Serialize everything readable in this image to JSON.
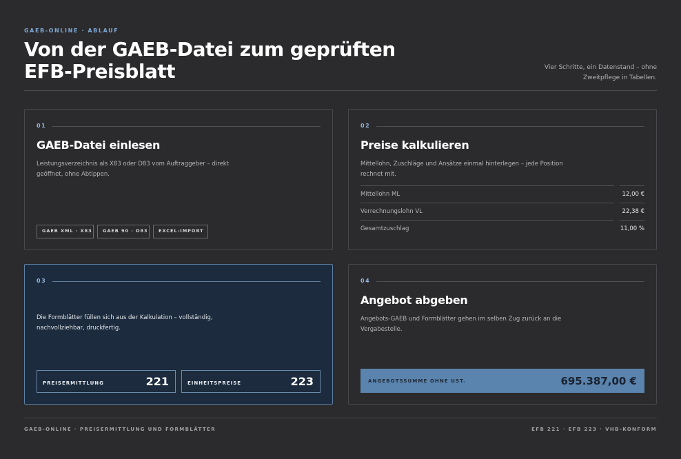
{
  "header": {
    "eyebrow": "GAEB-ONLINE · ABLAUF",
    "title": "Von der GAEB-Datei zum geprüften EFB-Preisblatt",
    "subtitle": "Vier Schritte, ein Datenstand – ohne Zweitpflege in Tabellen."
  },
  "steps": [
    {
      "num": "01",
      "title": "GAEB-Datei einlesen",
      "desc": "Leistungsverzeichnis als X83 oder D83 vom Auftraggeber – direkt geöffnet, ohne Abtippen.",
      "tags": [
        "GAEB XML · X83",
        "GAEB 90 · D83",
        "EXCEL-IMPORT"
      ]
    },
    {
      "num": "02",
      "title": "Preise kalkulieren",
      "desc": "Mittellohn, Zuschläge und Ansätze einmal hinterlegen – jede Position rechnet mit.",
      "params": [
        {
          "label": "Mittellohn ML",
          "value": "12,00 €"
        },
        {
          "label": "Verrechnungslohn VL",
          "value": "22,38 €"
        },
        {
          "label": "Gesamtzuschlag",
          "value": "11,00 %"
        }
      ]
    },
    {
      "num": "03",
      "desc": "Die Formblätter füllen sich aus der Kalkulation – vollständig, nachvollziehbar, druckfertig.",
      "stats": [
        {
          "label": "PREISERMITTLUNG",
          "value": "221"
        },
        {
          "label": "EINHEITSPREISE",
          "value": "223"
        }
      ]
    },
    {
      "num": "04",
      "title": "Angebot abgeben",
      "desc": "Angebots-GAEB und Formblätter gehen im selben Zug zurück an die Vergabestelle.",
      "sum_label": "ANGEBOTSSUMME OHNE UST.",
      "sum_value": "695.387,00 €"
    }
  ],
  "footer": {
    "left": "GAEB-ONLINE · PREISERMITTLUNG UND FORMBLÄTTER",
    "right": "EFB 221 · EFB 223 · VHB-KONFORM"
  },
  "colors": {
    "background": "#2b2b2d",
    "accent": "#7fa8d6",
    "highlight_card": "#1c2b3d",
    "sum_bar": "#5a83ad"
  }
}
